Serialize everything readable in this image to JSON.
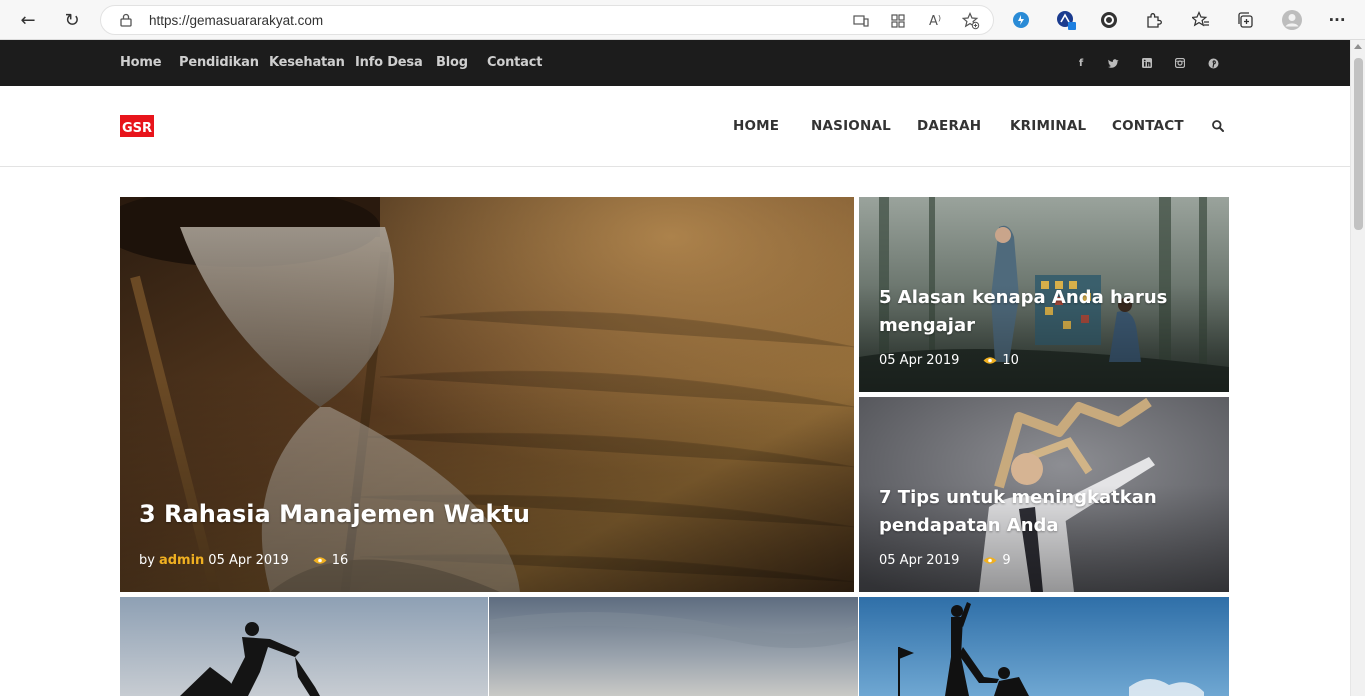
{
  "browser": {
    "url": "https://gemasuararakyat.com",
    "back_icon": "←",
    "reload_icon": "↻",
    "read_aloud_icon": "A⁾",
    "more_icon": "···"
  },
  "topbar": {
    "links": [
      "Home",
      "Pendidikan",
      "Kesehatan",
      "Info Desa",
      "Blog",
      "Contact"
    ],
    "social": [
      "f",
      "t",
      "in",
      "ig",
      "p"
    ]
  },
  "header": {
    "logo_text": "GSR",
    "nav": [
      "HOME",
      "NASIONAL",
      "DAERAH",
      "KRIMINAL",
      "CONTACT"
    ]
  },
  "featured": {
    "title": "3 Rahasia Manajemen Waktu",
    "by_label": "by",
    "author": "admin",
    "date": "05 Apr 2019",
    "views": "16"
  },
  "side_posts": [
    {
      "title_line1": "5 Alasan kenapa Anda harus",
      "title_line2": "mengajar",
      "date": "05 Apr 2019",
      "views": "10"
    },
    {
      "title_line1": "7 Tips untuk meningkatkan",
      "title_line2": "pendapatan Anda",
      "date": "05 Apr 2019",
      "views": "9"
    }
  ],
  "colors": {
    "accent": "#f0b021",
    "topbar_bg": "#1c1c1c",
    "logo_red": "#e8141b"
  }
}
